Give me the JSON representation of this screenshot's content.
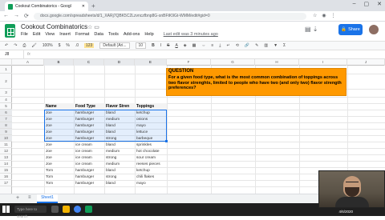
{
  "browser": {
    "tab_title": "Cookout Combinatorics - Googl",
    "url": "docs.google.com/spreadsheets/d/1_XARj7QBK5C2Lzvnczfbnp8G-snBFtK9Gt-WMM/edit#gid=0",
    "controls": [
      "–",
      "▢",
      "✕"
    ],
    "nav": [
      "←",
      "→",
      "⟳"
    ]
  },
  "sheets_header": {
    "doc_title": "Cookout Combinatorics",
    "menu": [
      "File",
      "Edit",
      "View",
      "Insert",
      "Format",
      "Data",
      "Tools",
      "Add-ons",
      "Help"
    ],
    "last_edit": "Last edit was 3 minutes ago",
    "share_label": "Share",
    "share_icon": "lock-icon"
  },
  "toolbar": {
    "zoom": "100%",
    "currency": "$",
    "percent": "%",
    "decimals": ".0",
    "more_formats": "123",
    "font": "Default (Ari...",
    "font_size": "10"
  },
  "formula_bar": {
    "cell_ref": "J8",
    "fx": "fx",
    "value": ""
  },
  "columns": [
    "A",
    "B",
    "C",
    "D",
    "E",
    "F",
    "G",
    "H",
    "I",
    "J"
  ],
  "rows": [
    "1",
    "2",
    "3",
    "4",
    "5",
    "6",
    "7",
    "8",
    "9",
    "10",
    "11",
    "12",
    "13",
    "14",
    "15",
    "16",
    "17"
  ],
  "question": {
    "title": "QUESTION",
    "text": "For a given food type, what is the most common combination of toppings across two flavor strenghts, limited to people who have two (and only two) flavor strength preferences?"
  },
  "table": {
    "headers": [
      "Name",
      "Food Type",
      "Flavor Stren",
      "Toppings"
    ],
    "rows": [
      [
        "Joe",
        "hamburger",
        "bland",
        "ketchup"
      ],
      [
        "Joe",
        "hamburger",
        "medium",
        "onions"
      ],
      [
        "Joe",
        "hamburger",
        "bland",
        "mayo"
      ],
      [
        "Joe",
        "hamburger",
        "bland",
        "lettuce"
      ],
      [
        "Joe",
        "hamburger",
        "strong",
        "barbeque"
      ],
      [
        "Joe",
        "ice cream",
        "bland",
        "sprinkles"
      ],
      [
        "Joe",
        "ice cream",
        "medium",
        "hot chocolate"
      ],
      [
        "Joe",
        "ice cream",
        "strong",
        "sour cream"
      ],
      [
        "Joe",
        "ice cream",
        "medium",
        "reeses pieces"
      ],
      [
        "Tom",
        "hamburger",
        "bland",
        "ketchup"
      ],
      [
        "Tom",
        "hamburger",
        "strong",
        "chili flakes"
      ],
      [
        "Tom",
        "hamburger",
        "bland",
        "mayo"
      ]
    ]
  },
  "sheet_tab": "Sheet1",
  "taskbar": {
    "search": "Type here to search",
    "time": "2:57 PM",
    "date": "4/6/2020"
  }
}
